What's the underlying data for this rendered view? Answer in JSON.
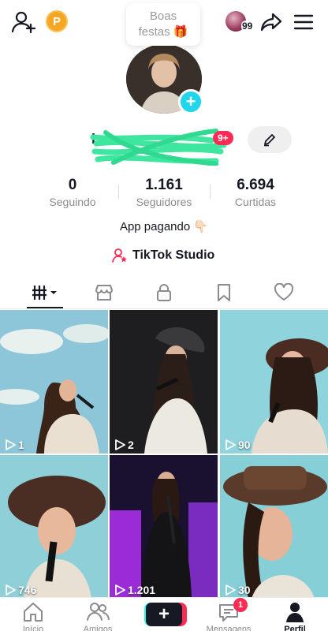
{
  "header": {
    "coin_letter": "P",
    "banner_line1": "Boas",
    "banner_line2": "festas 🎁",
    "friends_count": "99"
  },
  "profile": {
    "username_visible": "Is",
    "notification_badge": "9+"
  },
  "stats": [
    {
      "value": "0",
      "label": "Seguindo"
    },
    {
      "value": "1.161",
      "label": "Seguidores"
    },
    {
      "value": "6.694",
      "label": "Curtidas"
    }
  ],
  "bio": "App pagando 👇🏻",
  "studio_label": "TikTok Studio",
  "tabs": [
    {
      "icon": "videos-grid-icon",
      "active": true
    },
    {
      "icon": "shop-icon"
    },
    {
      "icon": "lock-icon"
    },
    {
      "icon": "bookmark-icon"
    },
    {
      "icon": "heart-icon"
    }
  ],
  "videos": [
    {
      "views": "1"
    },
    {
      "views": "2"
    },
    {
      "views": "90"
    },
    {
      "views": "746"
    },
    {
      "views": "1.201"
    },
    {
      "views": "30"
    }
  ],
  "bottom_nav": [
    {
      "label": "Início",
      "icon": "home-icon"
    },
    {
      "label": "Amigos",
      "icon": "friends-icon"
    },
    {
      "label": "",
      "icon": "create-icon"
    },
    {
      "label": "Mensagens",
      "icon": "inbox-icon",
      "badge": "1"
    },
    {
      "label": "Perfil",
      "icon": "profile-icon",
      "active": true
    }
  ],
  "colors": {
    "accent_red": "#fe2c55",
    "accent_cyan": "#20d5ec",
    "coin": "#f5a623"
  }
}
